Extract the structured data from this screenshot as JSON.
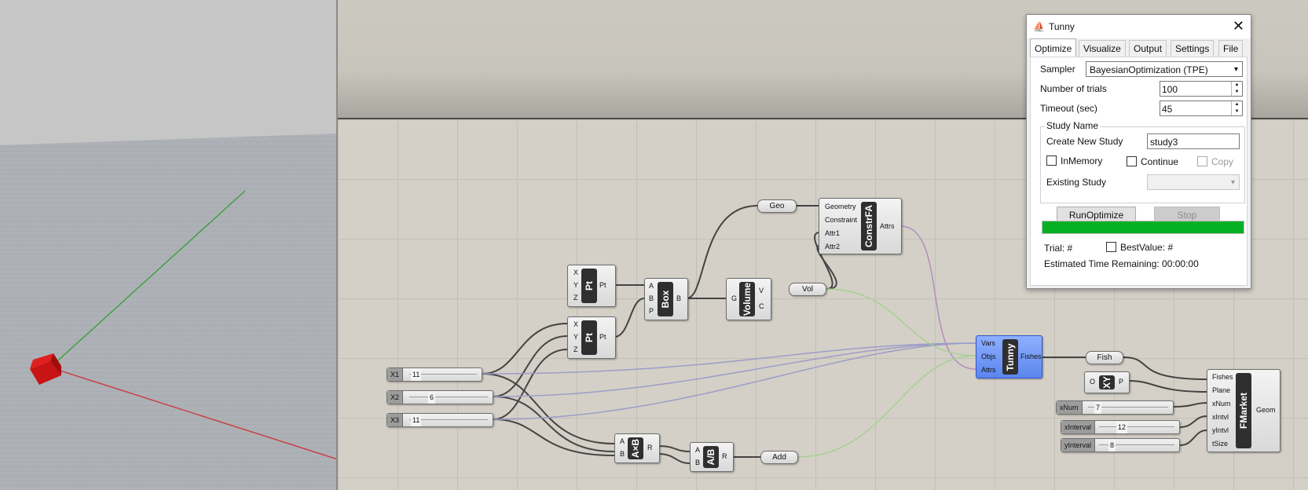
{
  "viewport": {
    "name": "rhino-perspective-viewport"
  },
  "canvas": {
    "sliders": [
      {
        "label": "X1",
        "value": "11"
      },
      {
        "label": "X2",
        "value": "6"
      },
      {
        "label": "X3",
        "value": "11"
      },
      {
        "label": "xNum",
        "value": "7"
      },
      {
        "label": "xInterval",
        "value": "12"
      },
      {
        "label": "yInterval",
        "value": "8"
      }
    ],
    "params": {
      "geo": "Geo",
      "vol": "Vol",
      "add": "Add",
      "fish": "Fish"
    },
    "pt1": {
      "nick": "Pt",
      "inputs": [
        "X",
        "Y",
        "Z"
      ],
      "output": "Pt"
    },
    "pt2": {
      "nick": "Pt",
      "inputs": [
        "X",
        "Y",
        "Z"
      ],
      "output": "Pt"
    },
    "box": {
      "nick": "Box",
      "inputs": [
        "A",
        "B",
        "P"
      ],
      "output": "B"
    },
    "volume": {
      "nick": "Volume",
      "inputs": [
        "G"
      ],
      "outputs": [
        "V",
        "C"
      ]
    },
    "constrfa": {
      "nick": "ConstrFA",
      "inputs": [
        "Geometry",
        "Constraint",
        "Attr1",
        "Attr2"
      ],
      "output": "Attrs"
    },
    "tunny": {
      "nick": "Tunny",
      "inputs": [
        "Vars",
        "Objs",
        "Attrs"
      ],
      "output": "Fishes"
    },
    "mult": {
      "nick": "A×B",
      "inputs": [
        "A",
        "B"
      ],
      "output": "R"
    },
    "div": {
      "nick": "A/B",
      "inputs": [
        "A",
        "B"
      ],
      "output": "R"
    },
    "xy": {
      "nick": "XY",
      "inputs": [
        "O"
      ],
      "output": "P"
    },
    "fmarket": {
      "nick": "FMarket",
      "inputs": [
        "Fishes",
        "Plane",
        "xNum",
        "xIntvl",
        "yIntvl",
        "tSize"
      ],
      "output": "Geom"
    }
  },
  "dialog": {
    "title": "Tunny",
    "close": "✕",
    "tabs": [
      "Optimize",
      "Visualize",
      "Output",
      "Settings",
      "File"
    ],
    "active_tab": "Optimize",
    "sampler_label": "Sampler",
    "sampler_value": "BayesianOptimization (TPE)",
    "trials_label": "Number of trials",
    "trials_value": "100",
    "timeout_label": "Timeout (sec)",
    "timeout_value": "45",
    "study_group": "Study Name",
    "create_label": "Create New Study",
    "create_value": "study3",
    "inmemory_label": "InMemory",
    "continue_label": "Continue",
    "copy_label": "Copy",
    "existing_label": "Existing Study",
    "run_button": "RunOptimize",
    "stop_button": "Stop",
    "progress_fraction": 1.0,
    "progress_color": "#06b025",
    "trial_label": "Trial: #",
    "best_label": "BestValue: #",
    "remaining_label": "Estimated Time Remaining: 00:00:00"
  },
  "colors": {
    "tunny_selected": "#6f97f5",
    "wire_dark": "#444444",
    "wire_purple": "#b48cc0",
    "wire_green": "#a8cf94",
    "axis_x": "#c83c3c",
    "axis_y": "#3ca03c"
  }
}
